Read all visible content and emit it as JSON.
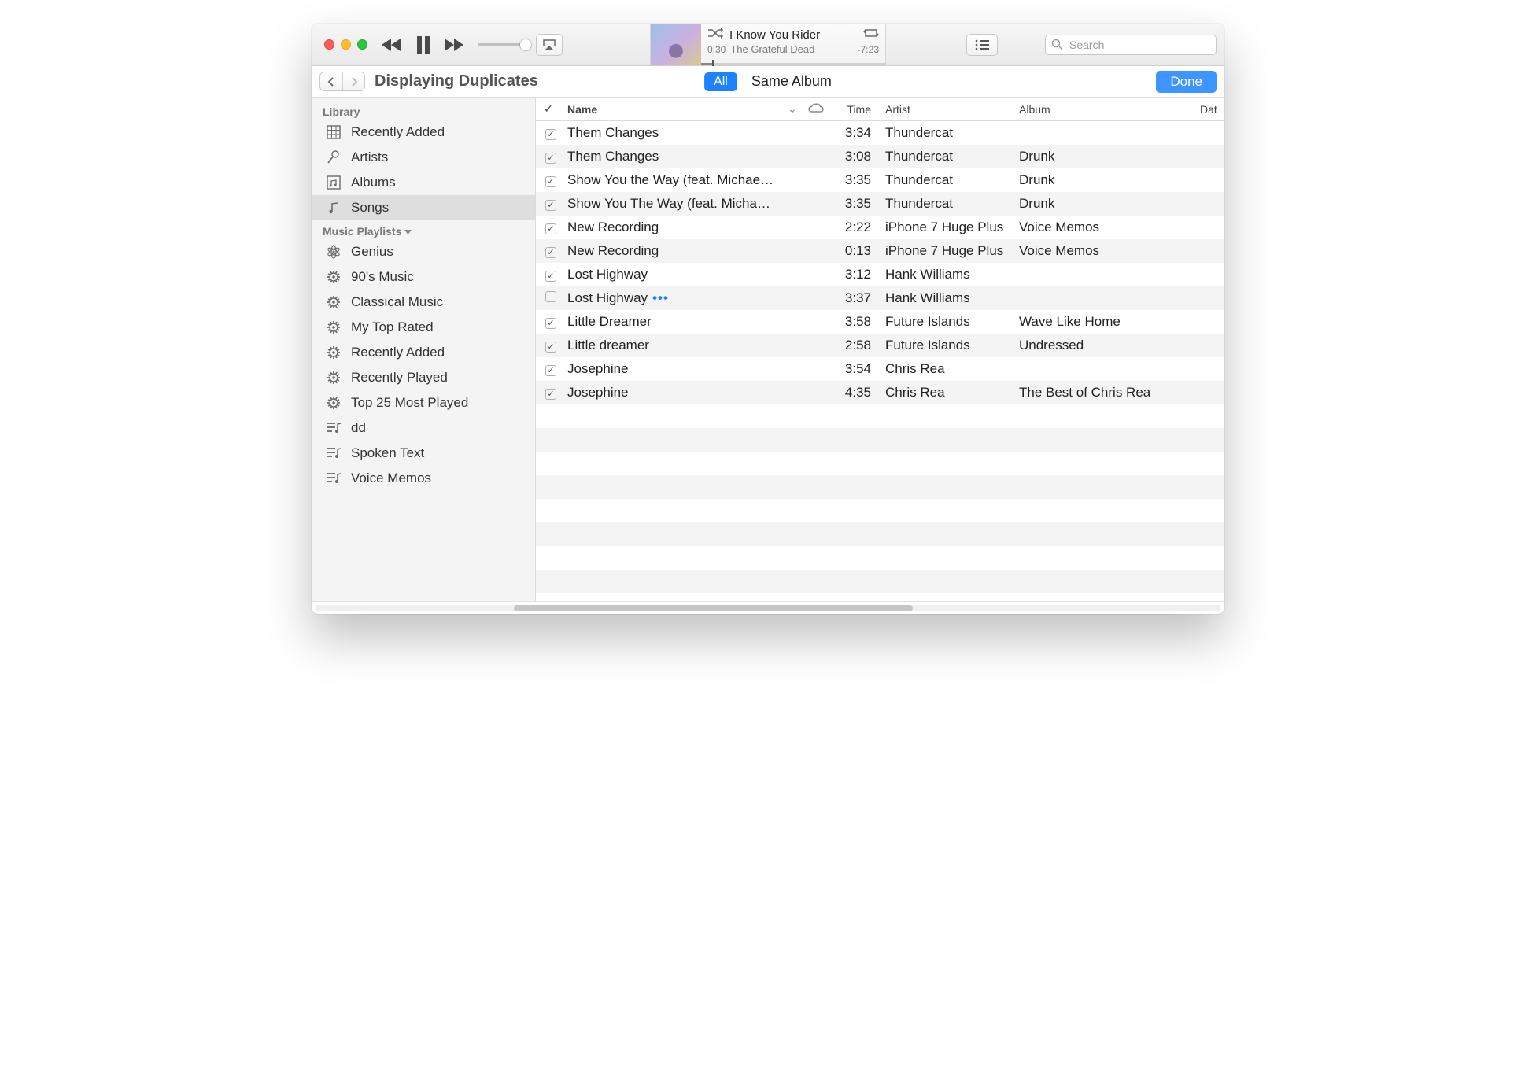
{
  "player": {
    "track_title": "I Know You Rider",
    "artist_line": "The Grateful Dead —",
    "elapsed": "0:30",
    "remaining": "-7:23"
  },
  "search": {
    "placeholder": "Search"
  },
  "subheader": {
    "title": "Displaying Duplicates",
    "filter_all": "All",
    "filter_same_album": "Same Album",
    "done": "Done"
  },
  "sidebar": {
    "heading_library": "Library",
    "heading_playlists": "Music Playlists",
    "library": [
      {
        "label": "Recently Added",
        "icon": "grid"
      },
      {
        "label": "Artists",
        "icon": "mic"
      },
      {
        "label": "Albums",
        "icon": "album"
      },
      {
        "label": "Songs",
        "icon": "note",
        "active": true
      }
    ],
    "playlists": [
      {
        "label": "Genius",
        "icon": "atom"
      },
      {
        "label": "90's Music",
        "icon": "gear"
      },
      {
        "label": "Classical Music",
        "icon": "gear"
      },
      {
        "label": "My Top Rated",
        "icon": "gear"
      },
      {
        "label": "Recently Added",
        "icon": "gear"
      },
      {
        "label": "Recently Played",
        "icon": "gear"
      },
      {
        "label": "Top 25 Most Played",
        "icon": "gear"
      },
      {
        "label": "dd",
        "icon": "playlist"
      },
      {
        "label": "Spoken Text",
        "icon": "playlist"
      },
      {
        "label": "Voice Memos",
        "icon": "playlist"
      }
    ]
  },
  "columns": {
    "name": "Name",
    "time": "Time",
    "artist": "Artist",
    "album": "Album",
    "date": "Dat"
  },
  "songs": [
    {
      "checked": true,
      "name": "Them Changes",
      "time": "3:34",
      "artist": "Thundercat",
      "album": ""
    },
    {
      "checked": true,
      "name": "Them Changes",
      "time": "3:08",
      "artist": "Thundercat",
      "album": "Drunk"
    },
    {
      "checked": true,
      "name": "Show You the Way (feat. Michael…",
      "time": "3:35",
      "artist": "Thundercat",
      "album": "Drunk"
    },
    {
      "checked": true,
      "name": "Show You The Way (feat. Michae…",
      "time": "3:35",
      "artist": "Thundercat",
      "album": "Drunk"
    },
    {
      "checked": true,
      "name": "New Recording",
      "time": "2:22",
      "artist": "iPhone 7 Huge Plus",
      "album": "Voice Memos"
    },
    {
      "checked": true,
      "name": "New Recording",
      "time": "0:13",
      "artist": "iPhone 7 Huge Plus",
      "album": "Voice Memos"
    },
    {
      "checked": true,
      "name": "Lost Highway",
      "time": "3:12",
      "artist": "Hank Williams",
      "album": ""
    },
    {
      "checked": false,
      "name": "Lost Highway",
      "showMore": true,
      "time": "3:37",
      "artist": "Hank Williams",
      "album": ""
    },
    {
      "checked": true,
      "name": "Little Dreamer",
      "time": "3:58",
      "artist": "Future Islands",
      "album": "Wave Like Home"
    },
    {
      "checked": true,
      "name": "Little dreamer",
      "time": "2:58",
      "artist": "Future Islands",
      "album": "Undressed"
    },
    {
      "checked": true,
      "name": "Josephine",
      "time": "3:54",
      "artist": "Chris Rea",
      "album": ""
    },
    {
      "checked": true,
      "name": "Josephine",
      "time": "4:35",
      "artist": "Chris Rea",
      "album": "The Best of Chris Rea"
    }
  ]
}
